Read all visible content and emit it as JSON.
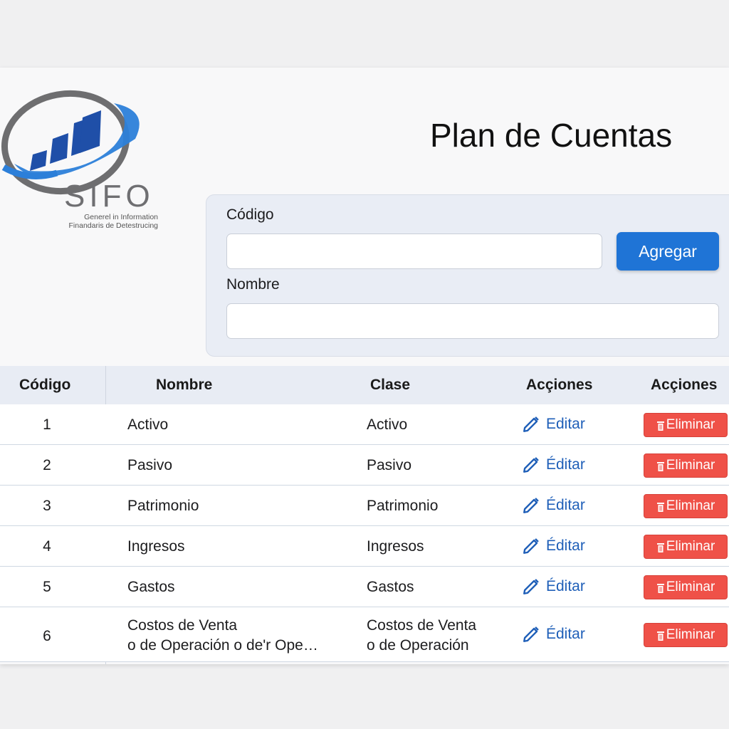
{
  "logo": {
    "name": "SIFO",
    "subtitle_line1": "Generel in Information",
    "subtitle_line2": "Finandaris de Detestrucing",
    "colors": {
      "ring_gray": "#6e6e70",
      "ring_blue": "#2c7fd9",
      "bars": "#1f4fa8"
    }
  },
  "header": {
    "title": "Plan de Cuentas"
  },
  "form": {
    "code_label": "Código",
    "code_value": "",
    "name_label": "Nombre",
    "name_value": "",
    "add_button_label": "Agregar"
  },
  "table": {
    "columns": [
      "Código",
      "Nombre",
      "Clase",
      "Acçiones",
      "Acçiones"
    ],
    "edit_label": "Editar",
    "edit_label_alt": "Éditar",
    "delete_label": "Eliminar",
    "rows": [
      {
        "code": "1",
        "name_line1": "Activo",
        "name_line2": "",
        "class_line1": "Activo",
        "class_line2": "",
        "edit": "Editar"
      },
      {
        "code": "2",
        "name_line1": "Pasivo",
        "name_line2": "",
        "class_line1": "Pasivo",
        "class_line2": "",
        "edit": "Éditar"
      },
      {
        "code": "3",
        "name_line1": "Patrimonio",
        "name_line2": "",
        "class_line1": "Patrimonio",
        "class_line2": "",
        "edit": "Éditar"
      },
      {
        "code": "4",
        "name_line1": "Ingresos",
        "name_line2": "",
        "class_line1": "Ingresos",
        "class_line2": "",
        "edit": "Éditar"
      },
      {
        "code": "5",
        "name_line1": "Gastos",
        "name_line2": "",
        "class_line1": "Gastos",
        "class_line2": "",
        "edit": "Éditar"
      },
      {
        "code": "6",
        "name_line1": "Costos de Venta",
        "name_line2": "o de Operación  o de'r Ope…",
        "class_line1": "Costos de Venta",
        "class_line2": "o de Operación",
        "edit": "Éditar"
      }
    ]
  },
  "colors": {
    "accent": "#1f74d6",
    "danger": "#ef5148",
    "link": "#1f5fb8",
    "header_bg": "#e8ecf4"
  }
}
